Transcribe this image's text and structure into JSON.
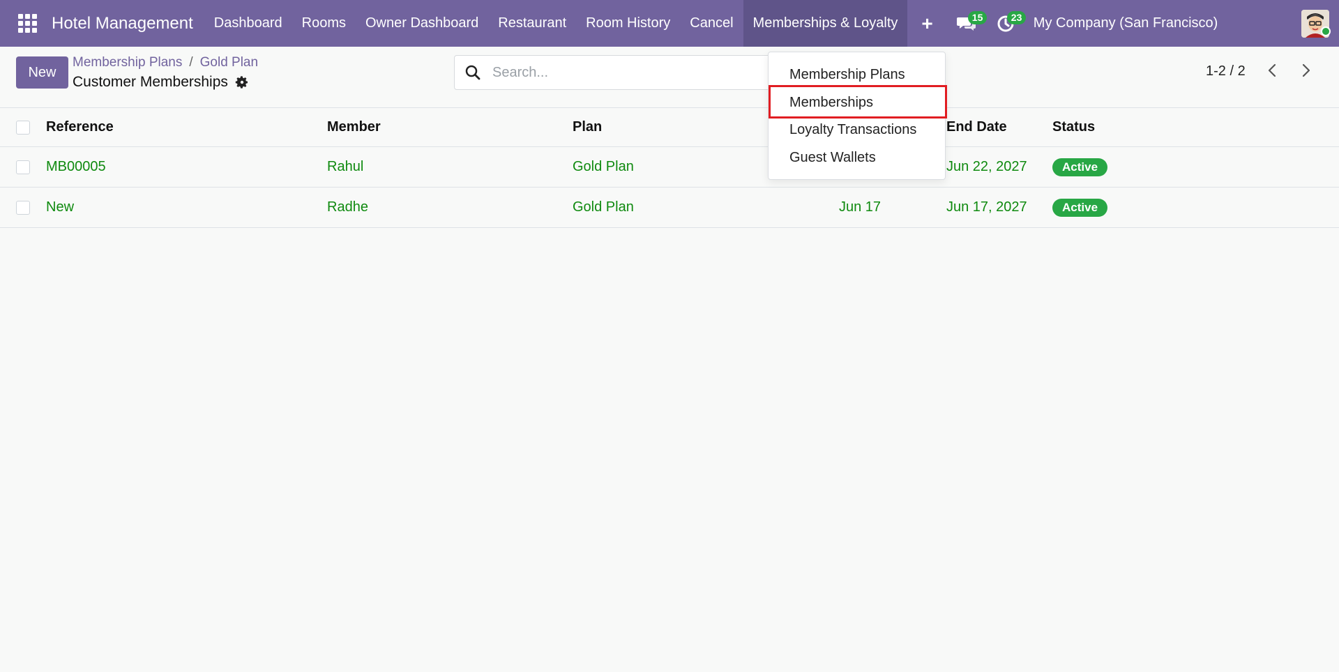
{
  "navbar": {
    "brand": "Hotel Management",
    "menu": [
      "Dashboard",
      "Rooms",
      "Owner Dashboard",
      "Restaurant",
      "Room History",
      "Cancel",
      "Memberships & Loyalty"
    ],
    "active_menu": "Memberships & Loyalty",
    "plus": "+",
    "messages_count": "15",
    "activities_count": "23",
    "company": "My Company (San Francisco)"
  },
  "control": {
    "new_label": "New",
    "breadcrumb": [
      "Membership Plans",
      "Gold Plan"
    ],
    "breadcrumb_sep": "/",
    "title": "Customer Memberships",
    "search_placeholder": "Search...",
    "pager": "1-2 / 2"
  },
  "table": {
    "headers": {
      "reference": "Reference",
      "member": "Member",
      "plan": "Plan",
      "end_date": "End Date",
      "status": "Status"
    },
    "rows": [
      {
        "reference": "MB00005",
        "member": "Rahul",
        "plan": "Gold Plan",
        "start_date": "",
        "end_date": "Jun 22, 2027",
        "status": "Active"
      },
      {
        "reference": "New",
        "member": "Radhe",
        "plan": "Gold Plan",
        "start_date": "Jun 17",
        "end_date": "Jun 17, 2027",
        "status": "Active"
      }
    ]
  },
  "dropdown": {
    "items": [
      "Membership Plans",
      "Memberships",
      "Loyalty Transactions",
      "Guest Wallets"
    ],
    "highlighted": "Memberships"
  },
  "colors": {
    "brand": "#71639e",
    "link": "#0f8a0f",
    "status_active": "#28a745",
    "highlight_border": "#e11d22"
  }
}
